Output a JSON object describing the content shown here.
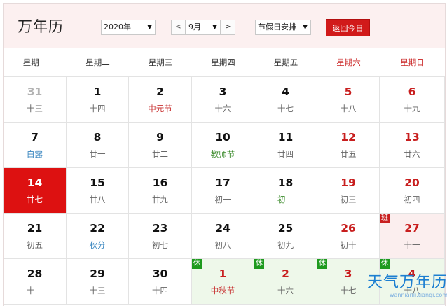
{
  "header": {
    "title": "万年历",
    "year_select": "2020年",
    "prev_label": "<",
    "month_select": "9月",
    "next_label": ">",
    "holiday_select": "节假日安排",
    "today_button": "返回今日",
    "dropdown_arrow": "▼"
  },
  "weekdays": [
    "星期一",
    "星期二",
    "星期三",
    "星期四",
    "星期五",
    "星期六",
    "星期日"
  ],
  "weeks": [
    [
      {
        "day": "31",
        "lunar": "十三",
        "other": true
      },
      {
        "day": "1",
        "lunar": "十四"
      },
      {
        "day": "2",
        "lunar": "中元节",
        "lunar_style": "fest"
      },
      {
        "day": "3",
        "lunar": "十六"
      },
      {
        "day": "4",
        "lunar": "十七"
      },
      {
        "day": "5",
        "lunar": "十八",
        "weekend": true
      },
      {
        "day": "6",
        "lunar": "十九",
        "weekend": true
      }
    ],
    [
      {
        "day": "7",
        "lunar": "白露",
        "lunar_style": "term"
      },
      {
        "day": "8",
        "lunar": "廿一"
      },
      {
        "day": "9",
        "lunar": "廿二"
      },
      {
        "day": "10",
        "lunar": "教师节",
        "lunar_style": "green"
      },
      {
        "day": "11",
        "lunar": "廿四"
      },
      {
        "day": "12",
        "lunar": "廿五",
        "weekend": true
      },
      {
        "day": "13",
        "lunar": "廿六",
        "weekend": true
      }
    ],
    [
      {
        "day": "14",
        "lunar": "廿七",
        "today": true
      },
      {
        "day": "15",
        "lunar": "廿八"
      },
      {
        "day": "16",
        "lunar": "廿九"
      },
      {
        "day": "17",
        "lunar": "初一"
      },
      {
        "day": "18",
        "lunar": "初二",
        "lunar_style": "green"
      },
      {
        "day": "19",
        "lunar": "初三",
        "weekend": true
      },
      {
        "day": "20",
        "lunar": "初四",
        "weekend": true
      }
    ],
    [
      {
        "day": "21",
        "lunar": "初五"
      },
      {
        "day": "22",
        "lunar": "秋分",
        "lunar_style": "term"
      },
      {
        "day": "23",
        "lunar": "初七"
      },
      {
        "day": "24",
        "lunar": "初八"
      },
      {
        "day": "25",
        "lunar": "初九"
      },
      {
        "day": "26",
        "lunar": "初十",
        "weekend": true
      },
      {
        "day": "27",
        "lunar": "十一",
        "weekend": true,
        "badge": "班",
        "badge_type": "work"
      }
    ],
    [
      {
        "day": "28",
        "lunar": "十二"
      },
      {
        "day": "29",
        "lunar": "十三"
      },
      {
        "day": "30",
        "lunar": "十四"
      },
      {
        "day": "1",
        "lunar": "中秋节",
        "lunar_style": "fest",
        "weekend": true,
        "badge": "休",
        "badge_type": "rest"
      },
      {
        "day": "2",
        "lunar": "十六",
        "weekend": true,
        "badge": "休",
        "badge_type": "rest"
      },
      {
        "day": "3",
        "lunar": "十七",
        "weekend": true,
        "badge": "休",
        "badge_type": "rest"
      },
      {
        "day": "4",
        "lunar": "十八",
        "weekend": true,
        "badge": "休",
        "badge_type": "rest"
      }
    ]
  ],
  "watermark": {
    "main": "天气万年历",
    "sub": "wannianli.tianqi.com"
  },
  "colors": {
    "accent": "#d11a1a",
    "header_bg": "#fcf0f0",
    "holiday_bg": "#eef8ea",
    "rest_badge": "#1e9a1e"
  }
}
